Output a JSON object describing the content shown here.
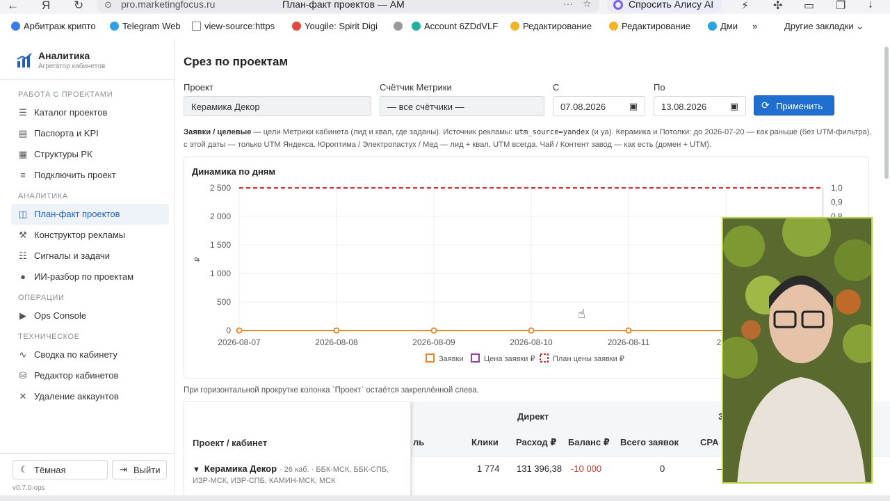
{
  "browser": {
    "url": "pro.marketingfocus.ru",
    "tab_title": "План-факт проектов — АМ",
    "alice_label": "Спросить Алису AI",
    "bookmarks": [
      {
        "label": "Арбитраж крипто",
        "color": "#3b7be8"
      },
      {
        "label": "Telegram Web",
        "color": "#2aa3e0"
      },
      {
        "label": "view-source:https",
        "color": "#777777"
      },
      {
        "label": "Yougile: Spirit Digi",
        "color": "#e04a3b"
      },
      {
        "label": "",
        "color": "#999999"
      },
      {
        "label": "Account 6ZDdVLF",
        "color": "#20b0a0"
      },
      {
        "label": "Редактирование",
        "color": "#f0b429"
      },
      {
        "label": "Редактирование",
        "color": "#f0b429"
      },
      {
        "label": "Дми",
        "color": "#2aa3e0"
      }
    ],
    "bookmarks_more": "»",
    "other_bookmarks": "Другие закладки"
  },
  "sidebar": {
    "brand_title": "Аналитика",
    "brand_subtitle": "Агрегатор кабинетов",
    "sections": {
      "projects": "РАБОТА С ПРОЕКТАМИ",
      "analytics": "АНАЛИТИКА",
      "operations": "ОПЕРАЦИИ",
      "technical": "ТЕХНИЧЕСКОЕ"
    },
    "items": {
      "catalog": "Каталог проектов",
      "passports": "Паспорта и KPI",
      "structures": "Структуры РК",
      "connect": "Подключить проект",
      "planfact": "План-факт проектов",
      "constructor": "Конструктор рекламы",
      "signals": "Сигналы и задачи",
      "ai": "ИИ-разбор по проектам",
      "ops": "Ops Console",
      "summary": "Сводка по кабинету",
      "editor": "Редактор кабинетов",
      "delete": "Удаление аккаунтов"
    },
    "dark_label": "Тёмная",
    "logout_label": "Выйти",
    "version": "v0.7.0-ops"
  },
  "main": {
    "title": "Срез по проектам",
    "filters": {
      "project_label": "Проект",
      "project_value": "Керамика Декор",
      "counter_label": "Счётчик Метрики",
      "counter_value": "— все счётчики —",
      "from_label": "С",
      "from_value": "07.08.2026",
      "to_label": "По",
      "to_value": "13.08.2026",
      "apply_label": "Применить"
    },
    "note": {
      "bold": "Заявки / целевые",
      "t1": " — цели Метрики кабинета (лид и квал, где заданы). Источник рекламы: ",
      "code": "utm_source=yandex",
      "t2": " (и ya). Керамика и Потолки: до 2026-07-20 — как раньше (без UTM-фильтра), с этой даты — только UTM Яндекса. Юроптима / Электропастух / Мед — лид + квал, UTM всегда. Чай / Контент завод — как есть (домен + UTM)."
    },
    "hint": "При горизонтальной прокрутке колонка `Проект` остаётся закреплённой слева.",
    "table": {
      "col_project": "Проект / кабинет",
      "group_direct": "Директ",
      "group_next": "З",
      "col_partial": "ль",
      "columns": [
        "Клики",
        "Расход ₽",
        "Баланс ₽",
        "Всего заявок",
        "CPA"
      ],
      "row": {
        "name": "Керамика Декор",
        "meta": "· 26 каб. · ББК-МСК, ББК-СПБ,",
        "meta2": "ИЗР-МСК, ИЗР-СПБ, КАМИН-МСК, МСК",
        "clicks": "1 774",
        "spend": "131 396,38",
        "balance": "-10 000",
        "leads": "0",
        "cpa": "—"
      }
    }
  },
  "chart_data": {
    "type": "line",
    "title": "Динамика по дням",
    "x": [
      "2026-08-07",
      "2026-08-08",
      "2026-08-09",
      "2026-08-10",
      "2026-08-11",
      "2026-08-12",
      "2026-08-13"
    ],
    "x_tick_labels_visible": [
      "2026-08-07",
      "2026-08-08",
      "2026-08-09",
      "2026-08-10",
      "2026-08-11",
      "2026"
    ],
    "ylabel": "₽",
    "ylim": [
      0,
      2500
    ],
    "y_ticks": [
      "0",
      "500",
      "1 000",
      "1 500",
      "2 000",
      "2 500"
    ],
    "y2lim": [
      0,
      1.0
    ],
    "y2_ticks_visible": [
      "1,0",
      "0,9",
      "0,8"
    ],
    "series": [
      {
        "name": "Заявки",
        "color": "#e8862a",
        "values": [
          0,
          0,
          0,
          0,
          0,
          0,
          0
        ]
      },
      {
        "name": "Цена заявки ₽",
        "color": "#8e3fa0",
        "values": [
          null,
          null,
          null,
          null,
          null,
          null,
          null
        ]
      },
      {
        "name": "План цены заявки ₽",
        "color": "#d62b2b",
        "dashed": true,
        "values": [
          2500,
          2500,
          2500,
          2500,
          2500,
          2500,
          2500
        ]
      }
    ],
    "grid": true,
    "legend": "bottom"
  }
}
